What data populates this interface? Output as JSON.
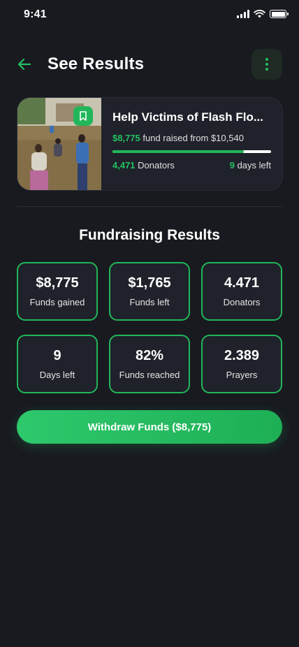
{
  "status_bar": {
    "time": "9:41"
  },
  "header": {
    "title": "See Results"
  },
  "campaign": {
    "title": "Help Victims of Flash Flo...",
    "raised": "$8,775",
    "raised_text": "fund raised from",
    "goal": "$10,540",
    "progress_fraction": 0.83,
    "donators_count": "4,471",
    "donators_label": "Donators",
    "days_count": "9",
    "days_label": "days left"
  },
  "results": {
    "title": "Fundraising Results",
    "stats": [
      {
        "value": "$8,775",
        "label": "Funds gained"
      },
      {
        "value": "$1,765",
        "label": "Funds left"
      },
      {
        "value": "4.471",
        "label": "Donators"
      },
      {
        "value": "9",
        "label": "Days left"
      },
      {
        "value": "82%",
        "label": "Funds reached"
      },
      {
        "value": "2.389",
        "label": "Prayers"
      }
    ]
  },
  "withdraw_button": {
    "label": "Withdraw Funds ($8,775)"
  },
  "colors": {
    "accent": "#22b65a",
    "background": "#181a20",
    "card": "#1f222a"
  },
  "icons": {
    "back": "arrow-left-icon",
    "more": "more-vertical-icon",
    "bookmark": "bookmark-icon"
  }
}
